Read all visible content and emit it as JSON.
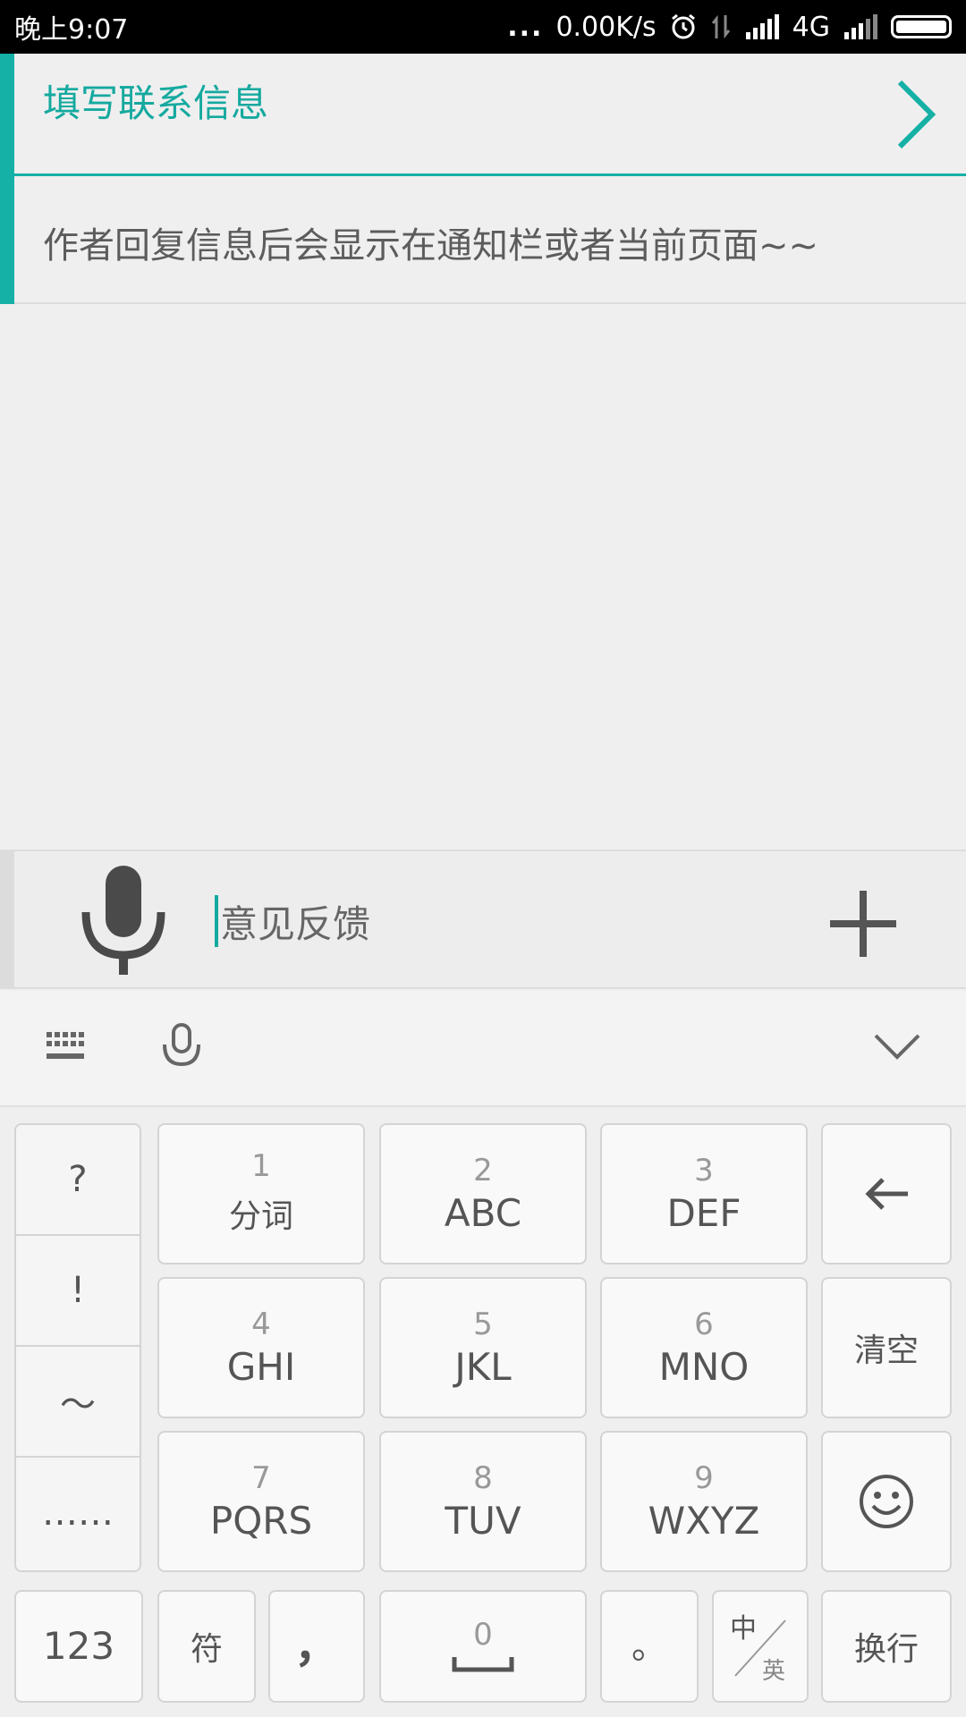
{
  "status_bar": {
    "time": "晚上9:07",
    "dots": "...",
    "speed": "0.00K/s",
    "network": "4G"
  },
  "contact": {
    "title": "填写联系信息",
    "description": "作者回复信息后会显示在通知栏或者当前页面~~"
  },
  "input": {
    "placeholder": "意见反馈"
  },
  "keyboard": {
    "side_symbols": [
      "?",
      "!",
      "～",
      "……"
    ],
    "keys": [
      {
        "num": "1",
        "label": "分词"
      },
      {
        "num": "2",
        "label": "ABC"
      },
      {
        "num": "3",
        "label": "DEF"
      },
      {
        "num": "4",
        "label": "GHI"
      },
      {
        "num": "5",
        "label": "JKL"
      },
      {
        "num": "6",
        "label": "MNO"
      },
      {
        "num": "7",
        "label": "PQRS"
      },
      {
        "num": "8",
        "label": "TUV"
      },
      {
        "num": "9",
        "label": "WXYZ"
      }
    ],
    "clear_label": "清空",
    "bottom": {
      "num_mode": "123",
      "symbol": "符",
      "comma": "，",
      "space_num": "0",
      "period": "。",
      "lang_top": "中",
      "lang_bottom": "英",
      "enter": "换行"
    }
  },
  "colors": {
    "accent": "#15b0a6"
  }
}
